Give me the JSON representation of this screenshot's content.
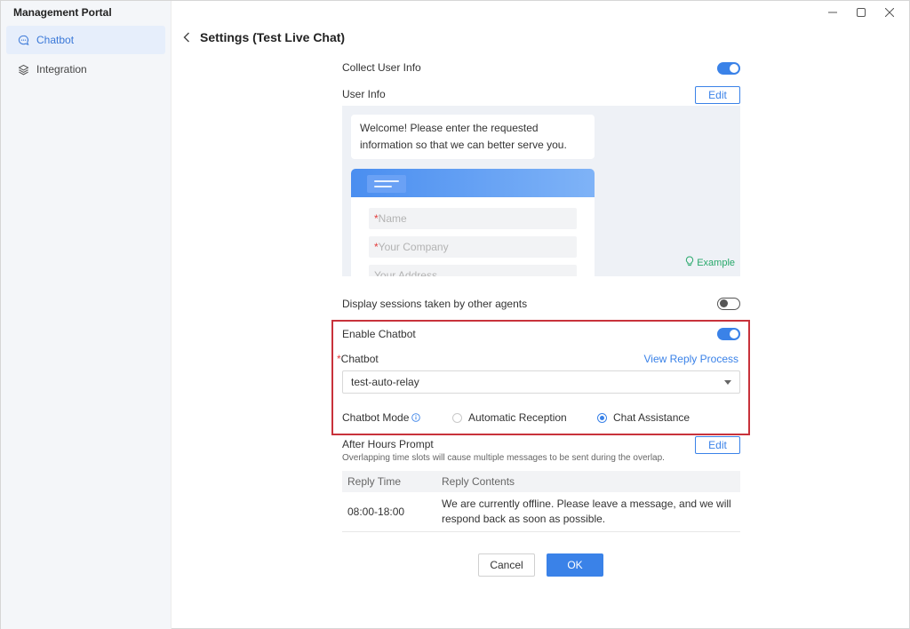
{
  "app": {
    "title": "Management Portal"
  },
  "sidebar": {
    "items": [
      {
        "label": "Chatbot",
        "icon": "chat-bubble-icon",
        "active": true
      },
      {
        "label": "Integration",
        "icon": "layers-icon",
        "active": false
      }
    ]
  },
  "header": {
    "title": "Settings (Test Live Chat)"
  },
  "form": {
    "collect_user_info": {
      "label": "Collect User Info",
      "enabled": true
    },
    "user_info": {
      "label": "User Info",
      "edit_label": "Edit"
    },
    "preview": {
      "welcome_text": "Welcome! Please enter the requested information so that we can better serve you.",
      "fields": [
        {
          "required": "*",
          "placeholder": "Name"
        },
        {
          "required": "*",
          "placeholder": "Your Company"
        },
        {
          "required": "",
          "placeholder": "Your Address"
        }
      ],
      "example_label": "Example"
    },
    "display_sessions": {
      "label": "Display sessions taken by other agents",
      "enabled": false
    },
    "enable_chatbot": {
      "label": "Enable Chatbot",
      "enabled": true
    },
    "chatbot": {
      "required_mark": "*",
      "label": "Chatbot",
      "view_reply_process": "View Reply Process",
      "selected_value": "test-auto-relay"
    },
    "chatbot_mode": {
      "label": "Chatbot Mode",
      "options": [
        {
          "label": "Automatic Reception",
          "checked": false
        },
        {
          "label": "Chat Assistance",
          "checked": true
        }
      ]
    },
    "after_hours": {
      "label": "After Hours Prompt",
      "edit_label": "Edit",
      "hint": "Overlapping time slots will cause multiple messages to be sent during the overlap.",
      "columns": [
        "Reply Time",
        "Reply Contents"
      ],
      "rows": [
        {
          "time": "08:00-18:00",
          "content": "We are currently offline. Please leave a message, and we will respond back as soon as possible."
        }
      ]
    }
  },
  "footer": {
    "cancel_label": "Cancel",
    "ok_label": "OK"
  },
  "colors": {
    "accent": "#3a82e8",
    "highlight": "#c8323b",
    "required": "#e23b3b",
    "example": "#27a86a"
  }
}
